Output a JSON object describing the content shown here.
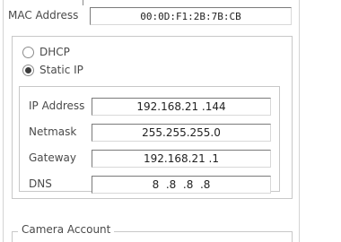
{
  "mac": {
    "label": "MAC Address",
    "value": "00:0D:F1:2B:7B:CB"
  },
  "address_mode": {
    "options": [
      {
        "label": "DHCP",
        "selected": false
      },
      {
        "label": "Static IP",
        "selected": true
      }
    ]
  },
  "static_ip": {
    "ip_label": "IP Address",
    "ip_value": "192.168.21 .144",
    "netmask_label": "Netmask",
    "netmask_value": "255.255.255.0",
    "gateway_label": "Gateway",
    "gateway_value": "192.168.21 .1",
    "dns_label": "DNS",
    "dns_value": "8  .8  .8  .8"
  },
  "camera_account": {
    "title": "Camera Account"
  }
}
